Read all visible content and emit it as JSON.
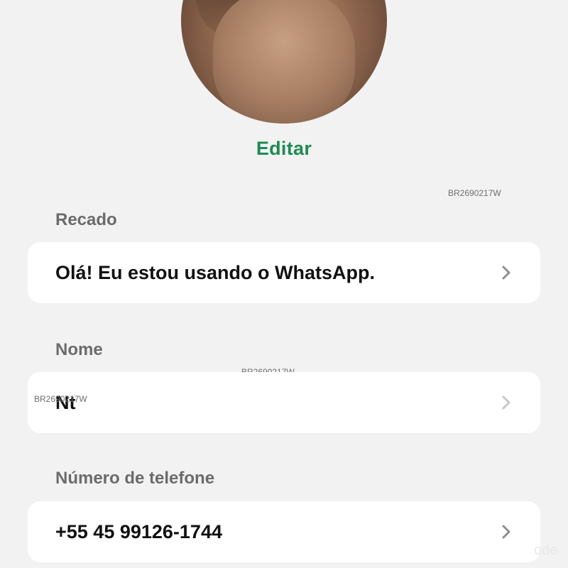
{
  "profile": {
    "edit_label": "Editar"
  },
  "watermarks": [
    "BR2690217W",
    "BR2690217W",
    "BR2690217W"
  ],
  "sections": {
    "about": {
      "label": "Recado",
      "value": "Olá! Eu estou usando o WhatsApp."
    },
    "name": {
      "label": "Nome",
      "value": "Nt"
    },
    "phone": {
      "label": "Número de telefone",
      "value": "+55 45 99126-1744"
    }
  },
  "corner_text": "ode",
  "icons": {
    "chevron": "chevron-right-icon"
  },
  "colors": {
    "accent": "#1f8a55",
    "background": "#f2f2f2",
    "card": "#ffffff",
    "label": "#6b6b6b",
    "chevron": "#8e8e93"
  }
}
